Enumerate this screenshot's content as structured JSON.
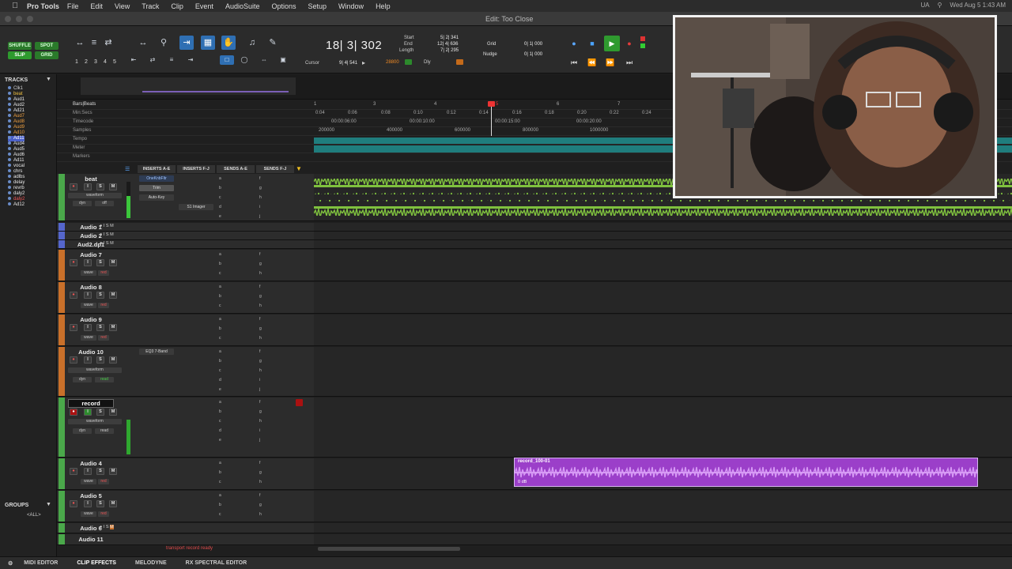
{
  "menubar": {
    "app": "Pro Tools",
    "items": [
      "File",
      "Edit",
      "View",
      "Track",
      "Clip",
      "Event",
      "AudioSuite",
      "Options",
      "Setup",
      "Window",
      "Help"
    ],
    "input_source": "UA",
    "clock": "Wed Aug 5  1:43 AM"
  },
  "window": {
    "title": "Edit: Too Close"
  },
  "toolbar": {
    "modes": {
      "shuffle": "SHUFFLE",
      "spot": "SPOT",
      "slip": "SLIP",
      "grid": "GRID"
    },
    "zoom_presets": [
      "1",
      "2",
      "3",
      "4",
      "5"
    ],
    "main_counter": "18| 3| 302",
    "cursor_label": "Cursor",
    "cursor_value": "9| 4| 541",
    "start_label": "Start",
    "end_label": "End",
    "length_label": "Length",
    "start_value": "5| 2| 341",
    "end_value": "12| 4| 636",
    "length_value": "7| 2| 295",
    "sample_count": "28800",
    "grid_label": "Grid",
    "grid_value": "0| 1| 000",
    "nudge_label": "Nudge",
    "nudge_value": "0| 1| 000",
    "dly_label": "Dly"
  },
  "tracks_panel": {
    "title": "TRACKS",
    "items": [
      "Clk1",
      "beat",
      "Aud1",
      "Aud2",
      "Ad21",
      "Aud7",
      "Aud8",
      "Aud9",
      "Ad10",
      "Ad11",
      "Aud4",
      "Aud5",
      "Aud6",
      "Ad11",
      "vocal",
      "chrs",
      "adlbs",
      "delay",
      "revrb",
      "daly2",
      "daly2",
      "Ad12"
    ],
    "groups_title": "GROUPS",
    "groups_all": "<ALL>"
  },
  "rulers": {
    "labels": [
      "Bars|Beats",
      "Min:Secs",
      "Timecode",
      "Samples",
      "Tempo",
      "Meter",
      "Markers"
    ],
    "bars": [
      "1",
      "3",
      "4",
      "5",
      "6",
      "7"
    ],
    "minsecs": [
      "0:04",
      "0:06",
      "0:08",
      "0:10",
      "0:12",
      "0:14",
      "0:16",
      "0:18",
      "0:20",
      "0:22",
      "0:24"
    ],
    "timecode": [
      "00:00:06:00",
      "00:00:10:00",
      "00:00:15:00",
      "00:00:20:00"
    ],
    "samples": [
      "200000",
      "400000",
      "600000",
      "800000",
      "1000000"
    ]
  },
  "columns": {
    "inserts_ae": "INSERTS A-E",
    "inserts_fj": "INSERTS F-J",
    "sends_ae": "SENDS A-E",
    "sends_fj": "SENDS F-J"
  },
  "tracks": [
    {
      "name": "beat",
      "inserts": [
        "OneKnbFltr",
        "Trim",
        "Auto-Key"
      ],
      "inserts_fj": [
        "S1 Imager"
      ],
      "view": "waveform",
      "dyn": "dyn",
      "auto": "off"
    },
    {
      "name": "Audio 1"
    },
    {
      "name": "Audio 2"
    },
    {
      "name": "Aud2.dp1"
    },
    {
      "name": "Audio 7",
      "view": "wave",
      "auto": "red"
    },
    {
      "name": "Audio 8",
      "view": "wave",
      "auto": "red"
    },
    {
      "name": "Audio 9",
      "view": "wave",
      "auto": "red"
    },
    {
      "name": "Audio 10",
      "inserts": [
        "EQ3 7-Band"
      ],
      "view": "waveform",
      "dyn": "dyn",
      "auto": "read"
    },
    {
      "name": "record",
      "view": "waveform",
      "dyn": "dyn",
      "auto": "read"
    },
    {
      "name": "Audio 4",
      "view": "wave",
      "auto": "red"
    },
    {
      "name": "Audio 5",
      "view": "wave",
      "auto": "red"
    },
    {
      "name": "Audio 6"
    },
    {
      "name": "Audio 11"
    }
  ],
  "clip": {
    "name": "record_100-01",
    "gain": "0 dB"
  },
  "status": {
    "message": "transport record ready"
  },
  "bottombar": [
    "MIDI EDITOR",
    "CLIP EFFECTS",
    "MELODYNE",
    "RX SPECTRAL EDITOR"
  ],
  "colors": {
    "beat_wave": "#7fc13e",
    "clip_purple": "#9b3fc9",
    "tempo_teal": "#1f7d7d",
    "record_green": "#33b833",
    "track_orange": "#c9702a",
    "track_green": "#4aa84a",
    "track_blue": "#5566cc",
    "play_green": "#33cc33",
    "rec_red": "#dd3333"
  }
}
